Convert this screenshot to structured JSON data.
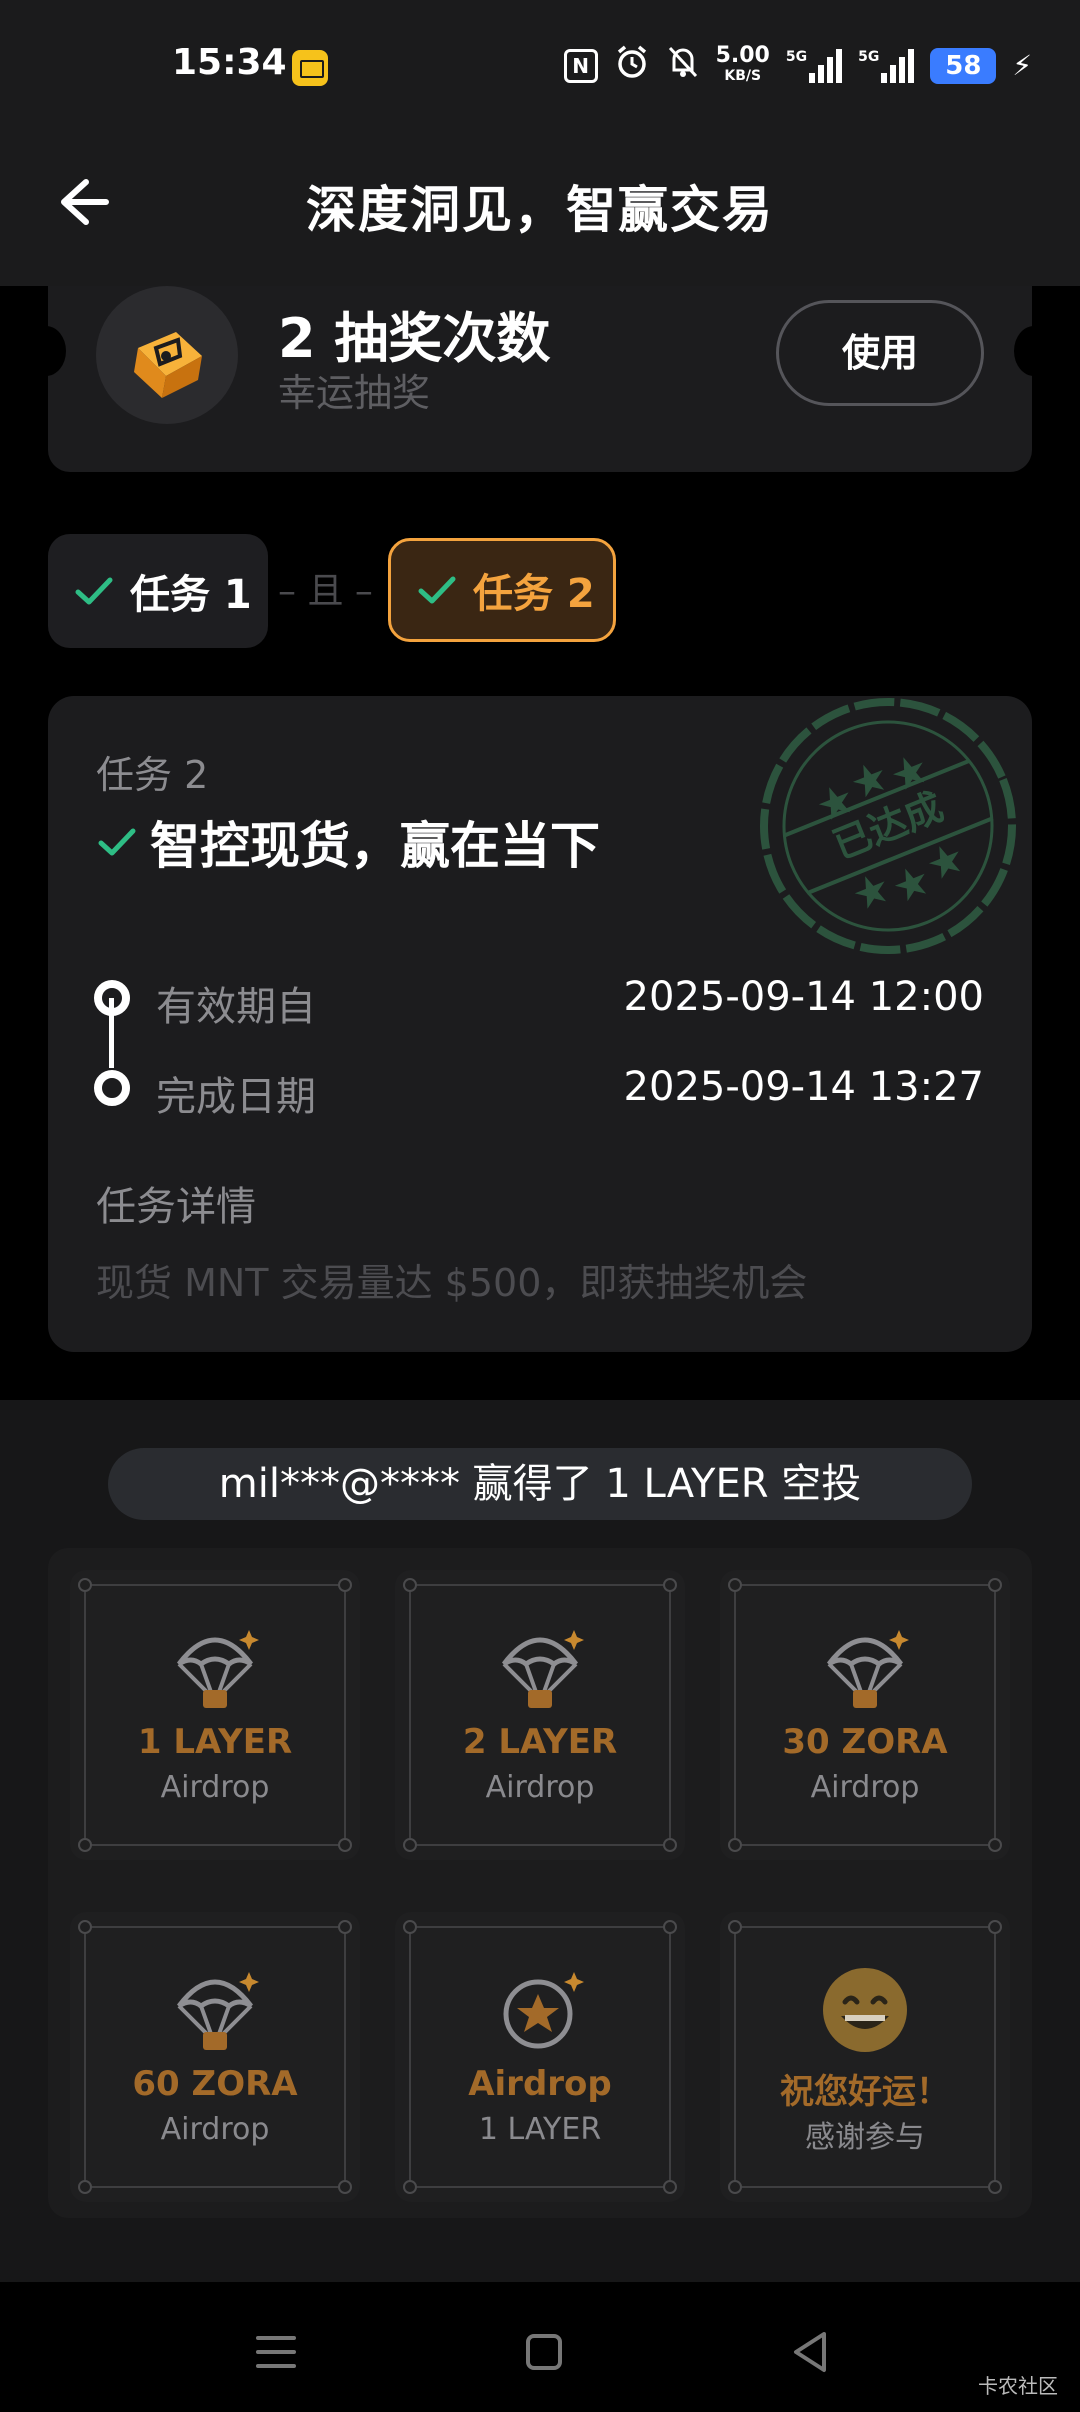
{
  "status_bar": {
    "time": "15:34",
    "net_speed": "5.00",
    "net_speed_unit": "KB/S",
    "signal1_label": "5G",
    "signal2_label": "5G",
    "battery": "58"
  },
  "header": {
    "title": "深度洞见，智赢交易"
  },
  "ticket": {
    "count_text": "2 抽奖次数",
    "subtitle": "幸运抽奖",
    "use_button": "使用"
  },
  "tasks": {
    "tab1_label": "任务 1",
    "separator": "– 且 –",
    "tab2_label": "任务 2"
  },
  "task_detail": {
    "label": "任务 2",
    "name": "智控现货，赢在当下",
    "stamp_text": "已达成",
    "valid_from_label": "有效期自",
    "valid_from_value": "2025-09-14 12:00",
    "completed_label": "完成日期",
    "completed_value": "2025-09-14 13:27",
    "details_label": "任务详情",
    "details_text": "现货 MNT 交易量达 $500，即获抽奖机会"
  },
  "lottery": {
    "winner_banner": "mil***@**** 赢得了 1 LAYER 空投",
    "prizes": [
      {
        "title": "1 LAYER",
        "subtitle": "Airdrop",
        "icon": "parachute-icon"
      },
      {
        "title": "2 LAYER",
        "subtitle": "Airdrop",
        "icon": "parachute-icon"
      },
      {
        "title": "30 ZORA",
        "subtitle": "Airdrop",
        "icon": "parachute-icon"
      },
      {
        "title": "60 ZORA",
        "subtitle": "Airdrop",
        "icon": "parachute-icon"
      },
      {
        "title": "Airdrop",
        "subtitle": "1 LAYER",
        "icon": "star-coin-icon"
      },
      {
        "title": "祝您好运！",
        "subtitle": "感谢参与",
        "icon": "grinning-face-icon"
      }
    ]
  },
  "colors": {
    "accent_orange": "#f4a33e",
    "prize_gold": "#a36a29",
    "success_green": "#2ebd85",
    "battery_blue": "#3a7cff"
  },
  "watermark": "卡农社区"
}
